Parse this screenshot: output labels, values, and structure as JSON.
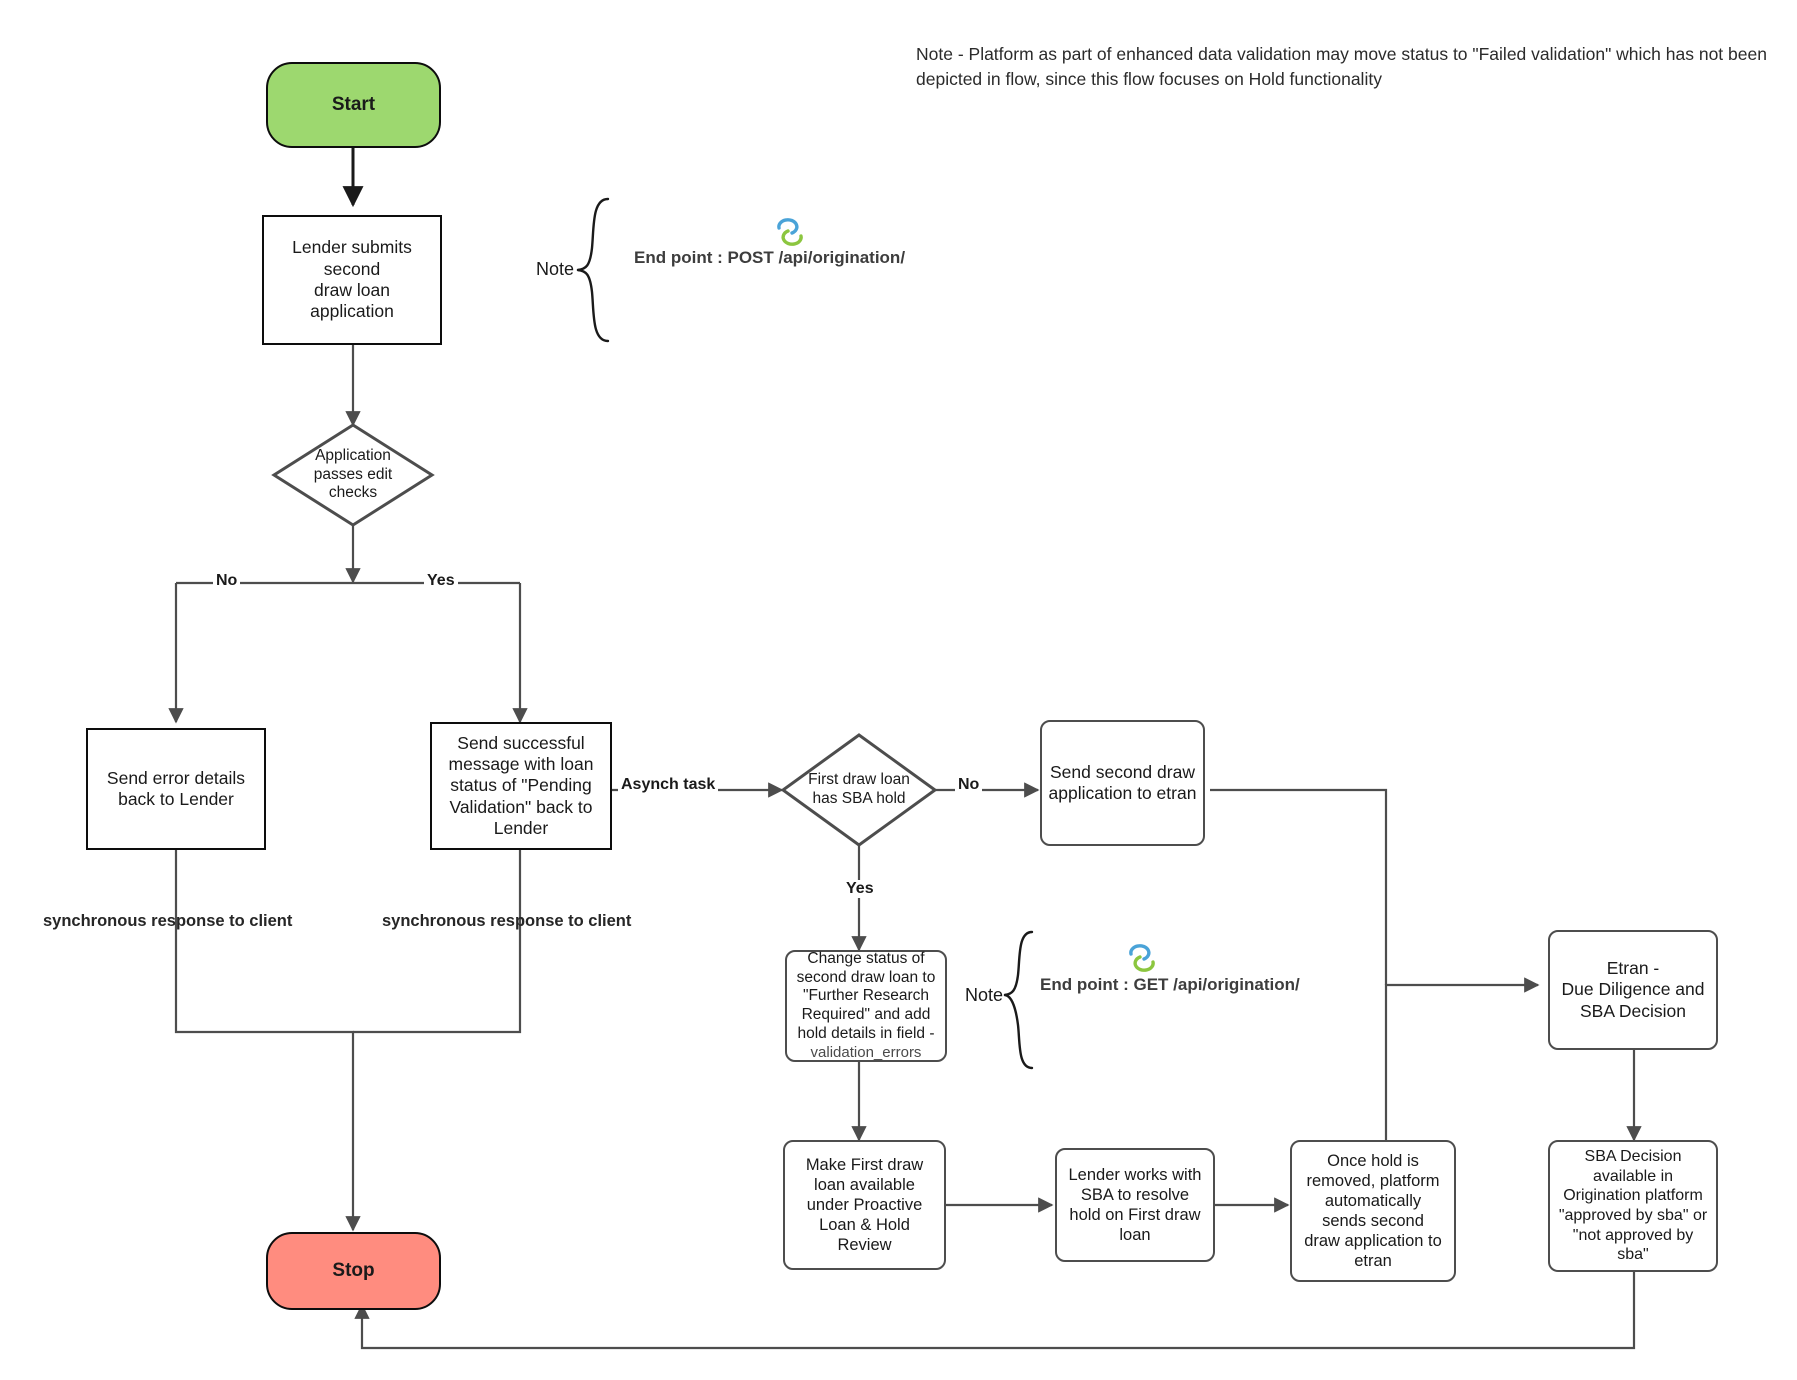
{
  "top_note": "Note - Platform as part of enhanced data validation may move status to \"Failed validation\" which has not been depicted in flow, since this flow focuses on Hold functionality",
  "nodes": {
    "start": "Start",
    "stop": "Stop",
    "lender_submits": "Lender submits second\ndraw loan application",
    "edit_checks": "Application\npasses edit\nchecks",
    "send_error": "Send error details\nback to Lender",
    "send_success": "Send successful\nmessage with loan\nstatus of \"Pending\nValidation\" back to\nLender",
    "sba_hold": "First draw loan\nhas SBA hold",
    "send_etran": "Send second draw\napplication to etran",
    "change_status_main": "Change status of\nsecond draw loan to\n\"Further Research\nRequired\" and add\nhold details in field -",
    "change_status_field": "validation_errors",
    "proactive_review": "Make First draw\nloan available\nunder Proactive\nLoan & Hold\nReview",
    "lender_works": "Lender works with\nSBA to resolve\nhold on First draw\nloan",
    "hold_removed": "Once hold is\nremoved, platform\nautomatically\nsends second\ndraw application to\netran",
    "etran_dd": "Etran -\nDue Diligence and\nSBA  Decision",
    "sba_decision": "SBA Decision\navailable in\nOrigination platform\n\"approved by sba\" or\n\"not approved by\nsba\""
  },
  "edge_labels": {
    "no_edit": "No",
    "yes_edit": "Yes",
    "asynch": "Asynch task",
    "no_hold": "No",
    "yes_hold": "Yes",
    "sync_left": "synchronous response to client",
    "sync_right": "synchronous response to client"
  },
  "notes": {
    "note1_label": "Note",
    "note1_endpoint": "End point : POST /api/origination/",
    "note2_label": "Note",
    "note2_endpoint": "End point : GET /api/origination/"
  },
  "colors": {
    "start_fill": "#9dd86f",
    "stop_fill": "#ff8c7f",
    "stroke_dark": "#0d0d0d",
    "stroke_grey": "#4d4d4d",
    "link_icon_blue": "#4aa3d8",
    "link_icon_green": "#8cc63f"
  },
  "icons": {
    "link1": "link-icon",
    "link2": "link-icon"
  }
}
